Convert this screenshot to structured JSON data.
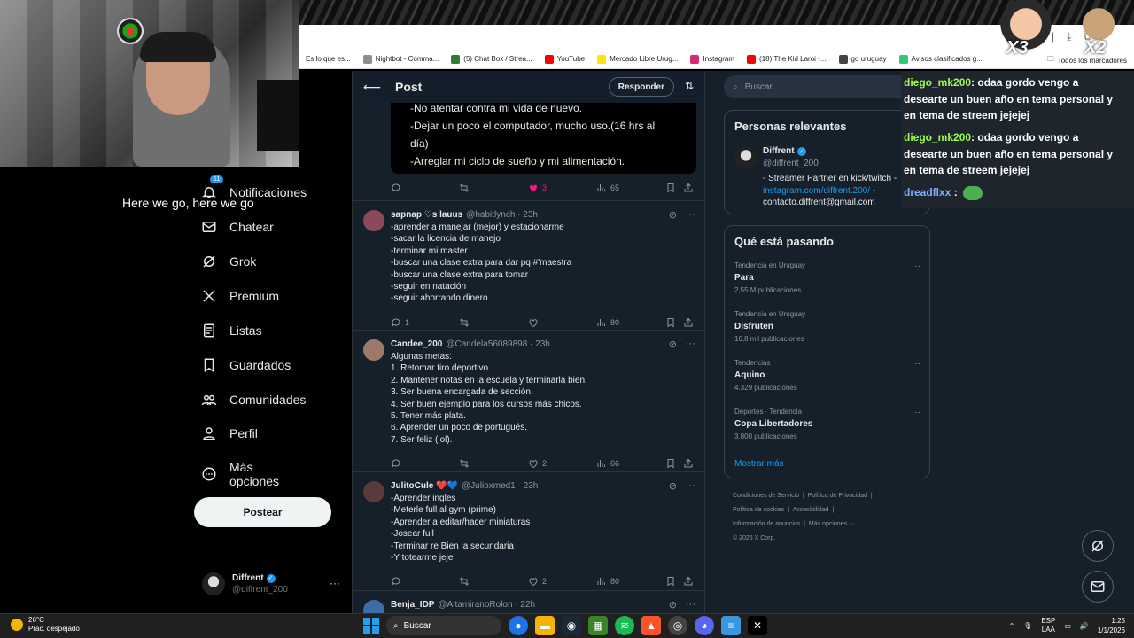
{
  "browser": {
    "bookmarks": [
      {
        "label": "Es lo que es...",
        "color": "#bbbbbb"
      },
      {
        "label": "Nightbot - Comma...",
        "color": "#8e8e8e"
      },
      {
        "label": "(5) Chat Box / Strea...",
        "color": "#2e7d32"
      },
      {
        "label": "YouTube",
        "color": "#ff0000"
      },
      {
        "label": "Mercado Libre Urug...",
        "color": "#ffe600"
      },
      {
        "label": "Instagram",
        "color": "#d62976"
      },
      {
        "label": "(18) The Kid Laroi -...",
        "color": "#ff0000"
      },
      {
        "label": "go uruguay",
        "color": "#444444"
      },
      {
        "label": "Avisos clasificados g...",
        "color": "#2ecc71"
      }
    ],
    "all_bookmarks": "Todos los marcadores"
  },
  "stream": {
    "caption": "Here we go, here we go"
  },
  "nav": {
    "items": [
      {
        "label": "Notificaciones",
        "icon": "bell-icon"
      },
      {
        "label": "Chatear",
        "icon": "mail-icon"
      },
      {
        "label": "Grok",
        "icon": "grok-icon"
      },
      {
        "label": "Premium",
        "icon": "x-logo-icon"
      },
      {
        "label": "Listas",
        "icon": "list-icon"
      },
      {
        "label": "Guardados",
        "icon": "bookmark-icon"
      },
      {
        "label": "Comunidades",
        "icon": "communities-icon"
      },
      {
        "label": "Perfil",
        "icon": "person-icon"
      },
      {
        "label": "Más opciones",
        "icon": "more-circle-icon"
      }
    ],
    "notif_badge": "11",
    "post_button": "Postear"
  },
  "account": {
    "name": "Diffrent",
    "handle": "@diffrent_200",
    "more": "···"
  },
  "feed": {
    "title": "Post",
    "reply_button": "Responder",
    "quoted_lines": [
      "-No atentar contra mi vida de nuevo.",
      "-Dejar un poco el computador, mucho uso.(16 hrs al",
      "día)",
      "-Arreglar mi ciclo de sueño y mi alimentación."
    ],
    "main_actions": {
      "reply": "",
      "retweet": "",
      "like": "3",
      "views": "65"
    },
    "tweets": [
      {
        "name": "sapnap ♡s lauus",
        "handle": "@habitlynch · 23h",
        "avatar_color": "#8a4a5a",
        "lines": [
          "-aprender a manejar (mejor) y estacionarme",
          "-sacar la licencia de manejo",
          "-terminar mi master",
          "-buscar una clase extra para dar pq #'maestra",
          "-buscar una clase extra para tomar",
          "-seguir en natación",
          "-seguir ahorrando dinero"
        ],
        "replies": "1",
        "retweets": "",
        "likes": "",
        "views": "80"
      },
      {
        "name": "Candee_200",
        "handle": "@Candela56089898 · 23h",
        "avatar_color": "#9c7a6a",
        "lines": [
          "Algunas metas:",
          "1. Retomar tiro deportivo.",
          "2. Mantener notas en la escuela y terminarla bien.",
          "3. Ser buena encargada de sección.",
          "4. Ser buen ejemplo para los cursos más chicos.",
          "5. Tener más plata.",
          "6. Aprender un poco de portugués.",
          "7. Ser feliz (lol)."
        ],
        "replies": "",
        "retweets": "",
        "likes": "2",
        "views": "66"
      },
      {
        "name": "JulitoCule ❤️💙",
        "handle": "@Julioxmed1 · 23h",
        "avatar_color": "#5a3a3a",
        "lines": [
          "-Aprender ingles",
          "-Meterle full al gym (prime)",
          "-Aprender a editar/hacer miniaturas",
          "-Josear full",
          "-Terminar re Bien la secundaria",
          "-Y totearme jeje"
        ],
        "replies": "",
        "retweets": "",
        "likes": "2",
        "views": "80"
      },
      {
        "name": "Benja_IDP",
        "handle": "@AltamiranoRolon · 22h",
        "avatar_color": "#3a6ea5",
        "lines": [],
        "replies": "",
        "retweets": "",
        "likes": "",
        "views": ""
      }
    ]
  },
  "right": {
    "search_placeholder": "Buscar",
    "relevant": {
      "title": "Personas relevantes",
      "name": "Diffrent",
      "handle": "@diffrent_200",
      "bio_line1": "- Streamer Partner en kick/twitch -",
      "bio_link": "instagram.com/diffrent.200/",
      "bio_after_link": " -",
      "bio_line3": "contacto.diffrent@gmail.com"
    },
    "trends_title": "Qué está pasando",
    "trends": [
      {
        "context": "Tendencia en Uruguay",
        "name": "Para",
        "count": "2,55 M publicaciones"
      },
      {
        "context": "Tendencia en Uruguay",
        "name": "Disfruten",
        "count": "16,8 mil publicaciones"
      },
      {
        "context": "Tendencias",
        "name": "Aquino",
        "count": "4.329 publicaciones"
      },
      {
        "context": "Deportes · Tendencia",
        "name": "Copa Libertadores",
        "count": "3.800 publicaciones"
      }
    ],
    "show_more": "Mostrar más",
    "footer": [
      "Condiciones de Servicio",
      "Política de Privacidad",
      "Política de cookies",
      "Accesibilidad",
      "Información de anuncios",
      "Más opciones ···",
      "© 2026 X Corp."
    ]
  },
  "chat": {
    "messages": [
      {
        "user": "diego_mk200",
        "text": ": odaa gordo vengo a desearte un buen año en tema personal y en tema de streem jejejej"
      },
      {
        "user": "diego_mk200",
        "text": ": odaa gordo vengo a desearte un buen año en tema personal y en tema de streem jejejej"
      },
      {
        "user": "dreadflxx",
        "text": " :"
      }
    ],
    "emote_x3": "X3",
    "emote_x2": "X2"
  },
  "taskbar": {
    "temp": "26°C",
    "weather": "Prac. despejado",
    "search": "Buscar",
    "lang_top": "ESP",
    "lang_bottom": "LAA",
    "time": "1:25",
    "date": "1/1/2026"
  }
}
